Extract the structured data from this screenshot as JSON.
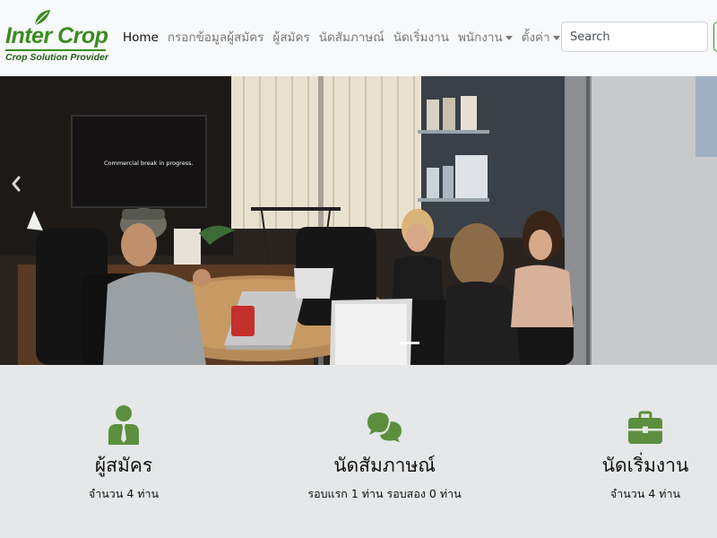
{
  "brand": {
    "name": "Inter Crop",
    "tagline": "Crop Solution Provider"
  },
  "nav": {
    "home": "Home",
    "fill_applicant": "กรอกข้อมูลผู้สมัคร",
    "applicants": "ผู้สมัคร",
    "interview": "นัดสัมภาษณ์",
    "start_work": "นัดเริ่มงาน",
    "employees": "พนักงาน",
    "settings": "ตั้งค่า"
  },
  "search": {
    "placeholder": "Search"
  },
  "carousel": {
    "screen_text": "Commercial break in progress.",
    "slides": 2,
    "active_slide": 1
  },
  "features": [
    {
      "icon": "person-tie-icon",
      "title": "ผู้สมัคร",
      "text": "จำนวน 4 ท่าน"
    },
    {
      "icon": "chat-bubbles-icon",
      "title": "นัดสัมภาษณ์",
      "text": "รอบแรก 1 ท่าน รอบสอง 0 ท่าน"
    },
    {
      "icon": "briefcase-icon",
      "title": "นัดเริ่มงาน",
      "text": "จำนวน 4 ท่าน"
    }
  ],
  "colors": {
    "accent": "#3c8a22",
    "icon_green": "#5b8f3d",
    "navbar": "#f8f9fa",
    "features_bg": "#e5e7e8"
  }
}
